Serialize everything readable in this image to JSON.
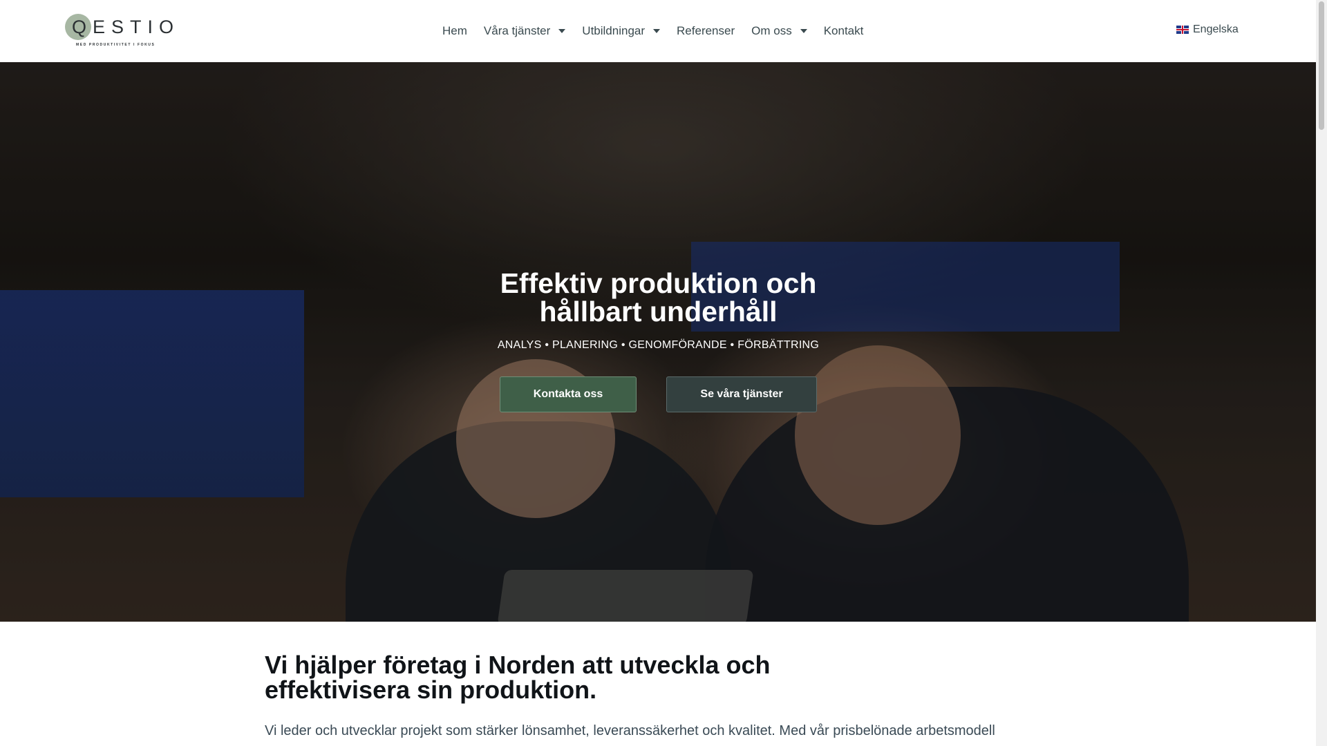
{
  "header": {
    "logo_text": "QESTIO",
    "logo_tagline": "MED PRODUKTIVITET I FOKUS",
    "nav": [
      {
        "label": "Hem",
        "has_dropdown": false
      },
      {
        "label": "Våra tjänster",
        "has_dropdown": true
      },
      {
        "label": "Utbildningar",
        "has_dropdown": true
      },
      {
        "label": "Referenser",
        "has_dropdown": false
      },
      {
        "label": "Om oss",
        "has_dropdown": true
      },
      {
        "label": "Kontakt",
        "has_dropdown": false
      }
    ],
    "language_label": "Engelska",
    "language_icon": "uk-flag-icon"
  },
  "hero": {
    "title": "Effektiv produktion och hållbart underhåll",
    "subtitle": "ANALYS • PLANERING • GENOMFÖRANDE • FÖRBÄTTRING",
    "primary_button": "Kontakta oss",
    "secondary_button": "Se våra tjänster"
  },
  "intro": {
    "heading": "Vi hjälper företag i Norden att utveckla och effektivisera sin produktion.",
    "paragraph": "Vi leder och utvecklar projekt som stärker lönsamhet, leveranssäkerhet och kvalitet.  Med vår prisbelönade arbetsmodell"
  },
  "colors": {
    "accent_green": "#3f5f48",
    "secondary_dark": "#33403f",
    "logo_circle": "#a7b7a3"
  }
}
